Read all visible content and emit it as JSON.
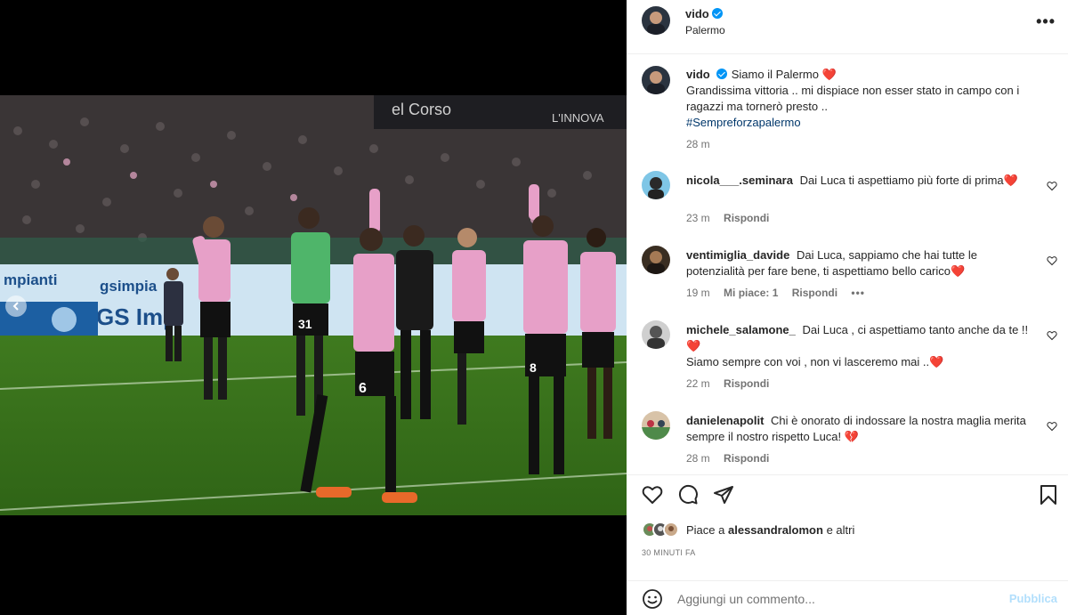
{
  "post": {
    "author": "vido",
    "location": "Palermo",
    "caption_title": "Siamo il Palermo",
    "caption_emoji": "❤️",
    "caption_text": "Grandissima vittoria .. mi dispiace non esser stato in campo con i ragazzi ma tornerò presto ..",
    "hashtag": "#Sempreforzapalermo",
    "caption_time": "28 m"
  },
  "comments": [
    {
      "user": "nicola___.seminara",
      "text": "Dai Luca ti aspettiamo più forte di prima❤️",
      "time": "23 m",
      "likes_label": "",
      "reply_label": "Rispondi"
    },
    {
      "user": "ventimiglia_davide",
      "text": "Dai Luca, sappiamo che hai tutte le potenzialità per fare bene, ti aspettiamo bello carico❤️",
      "time": "19 m",
      "likes_label": "Mi piace: 1",
      "reply_label": "Rispondi"
    },
    {
      "user": "michele_salamone_",
      "text": "Dai Luca , ci aspettiamo tanto anche da te !! ❤️",
      "text2": "Siamo sempre con voi , non vi lasceremo mai ..❤️",
      "time": "22 m",
      "likes_label": "",
      "reply_label": "Rispondi"
    },
    {
      "user": "danielenapolit",
      "text": "Chi è onorato di indossare la nostra maglia merita sempre il nostro rispetto Luca! 💔",
      "time": "28 m",
      "likes_label": "",
      "reply_label": "Rispondi"
    }
  ],
  "likes": {
    "prefix": "Piace a",
    "user": "alessandralomon",
    "suffix": "e altri"
  },
  "timestamp": "30 MINUTI FA",
  "add_comment": {
    "placeholder": "Aggiungi un commento...",
    "publish_label": "Pubblica"
  },
  "more_label": "•••",
  "icons": [
    "heart-icon",
    "comment-icon",
    "share-icon",
    "bookmark-icon",
    "emoji-icon",
    "more-icon",
    "chevron-left-icon",
    "verified-icon"
  ],
  "colors": {
    "link": "#00376b",
    "verified": "#0095f6",
    "muted": "#737373",
    "publish": "#b2dffc",
    "heart": "#ed4956"
  }
}
